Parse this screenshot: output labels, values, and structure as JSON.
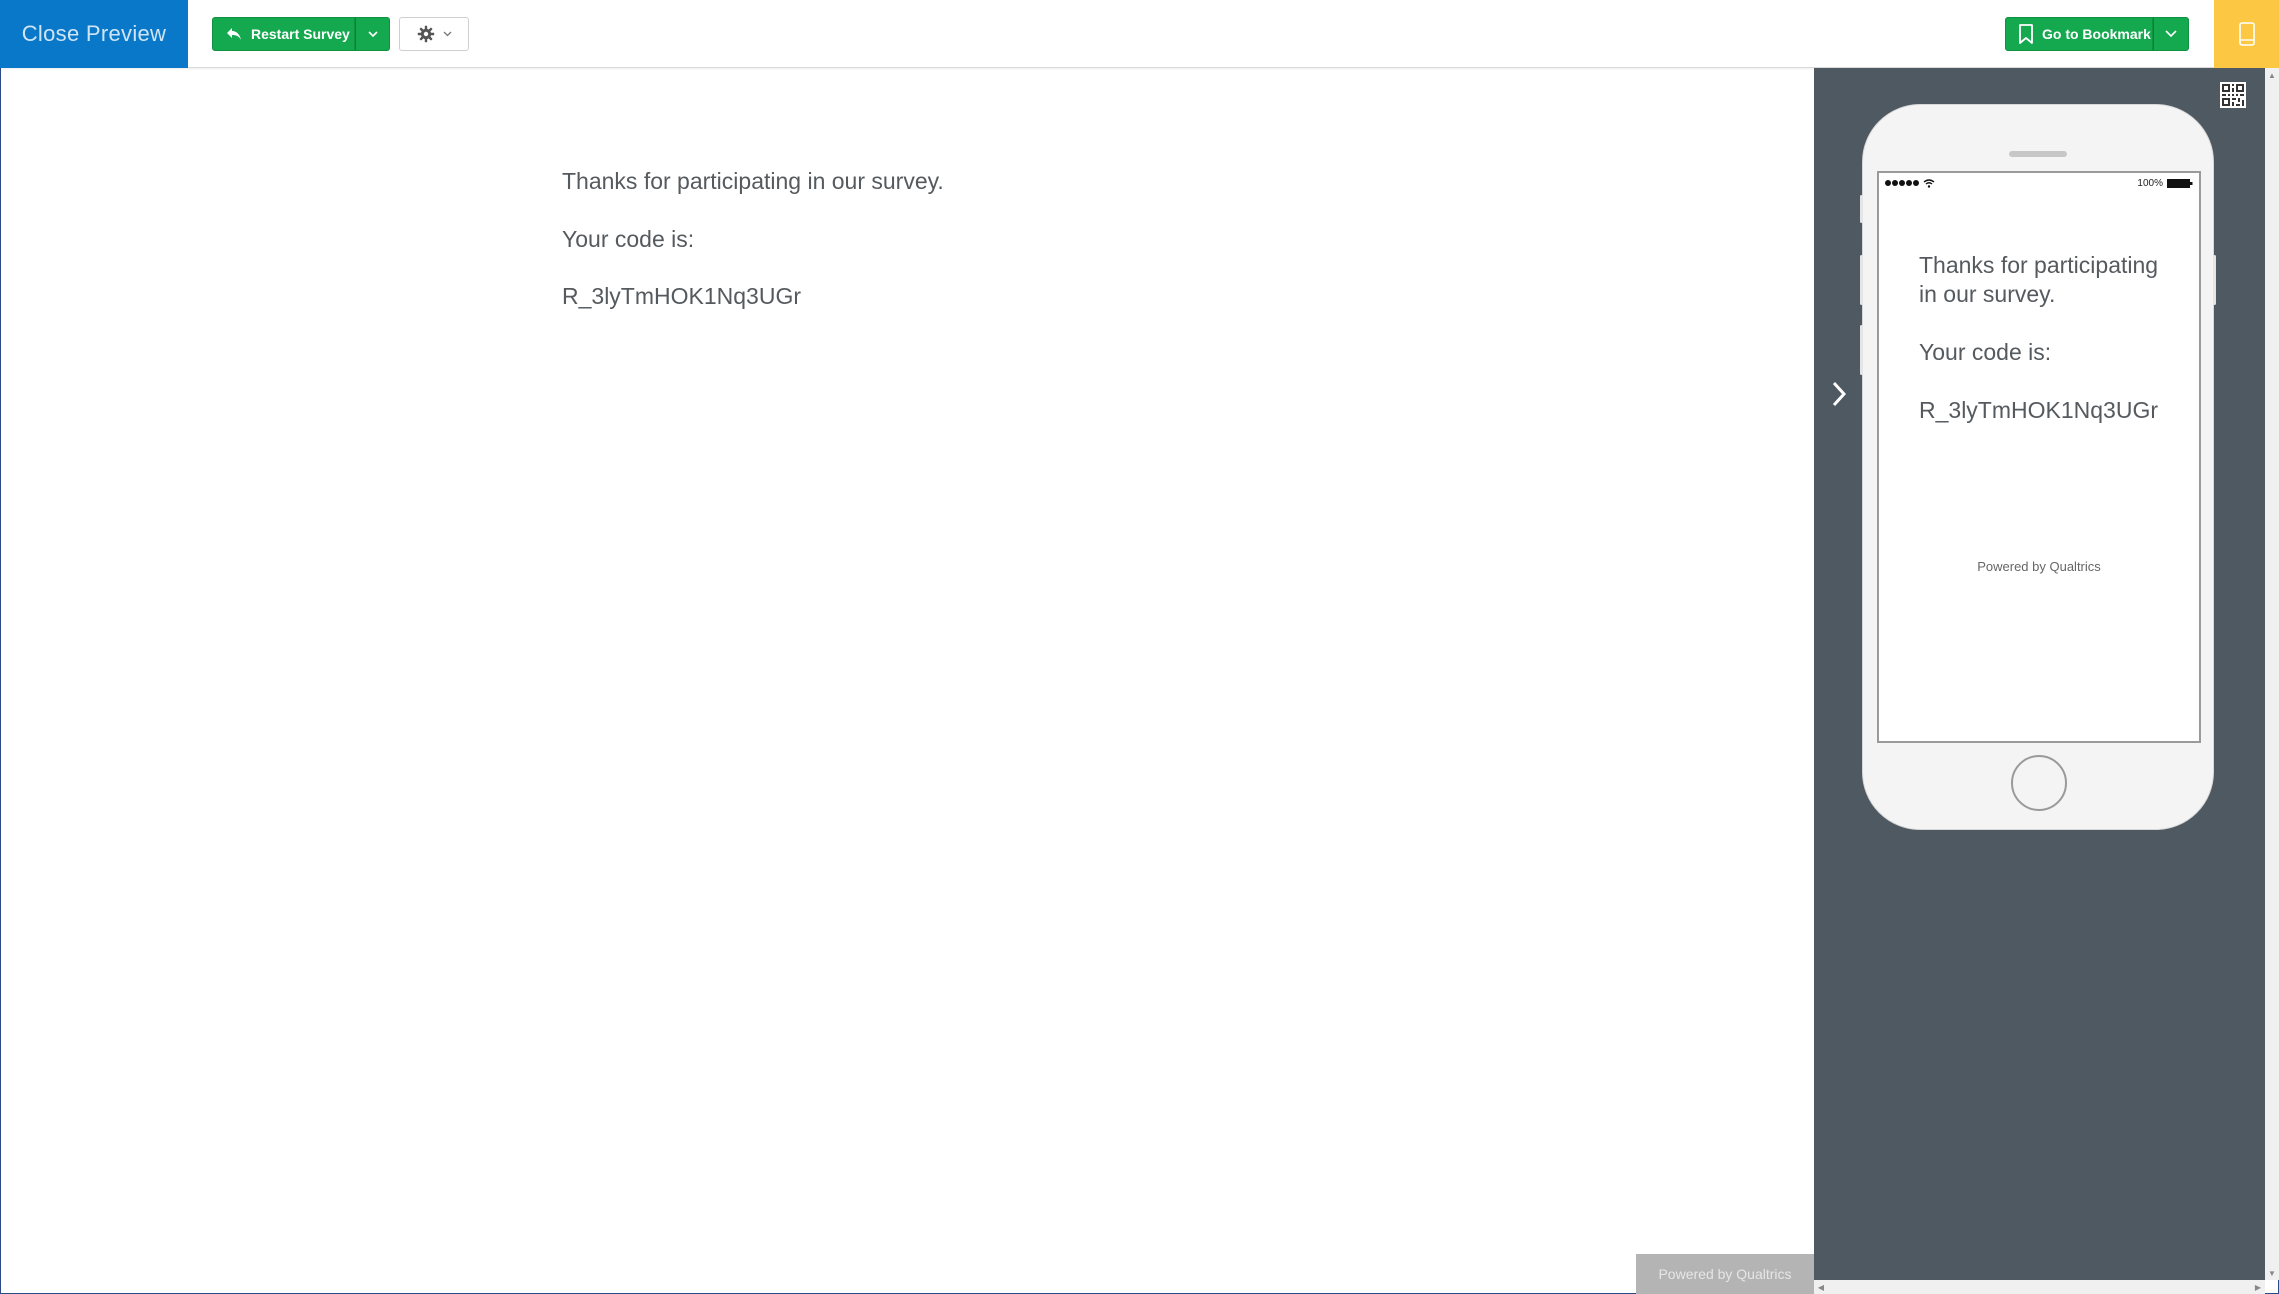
{
  "topbar": {
    "close_preview_label": "Close Preview",
    "restart_label": "Restart Survey",
    "bookmark_label": "Go to Bookmark"
  },
  "survey": {
    "thanks": "Thanks for participating in our survey.",
    "code_label": "Your code is:",
    "code_value": "R_3lyTmHOK1Nq3UGr"
  },
  "footer": {
    "powered_by": "Powered by Qualtrics"
  },
  "mobile_preview": {
    "battery": "100%",
    "thanks": "Thanks for participating in our survey.",
    "code_label": "Your code is:",
    "code_value": "R_3lyTmHOK1Nq3UGr",
    "powered_by": "Powered by Qualtrics"
  },
  "colors": {
    "close_preview_bg": "#0a78c8",
    "action_green": "#14a84f",
    "device_toggle_bg": "#fcc843",
    "panel_bg": "#4e5961"
  },
  "icons": {
    "restart": "undo-arrow-icon",
    "settings": "gear-icon",
    "bookmark": "bookmark-icon",
    "device": "mobile-phone-icon",
    "collapse": "chevron-right-icon",
    "qr": "qr-code-icon"
  }
}
